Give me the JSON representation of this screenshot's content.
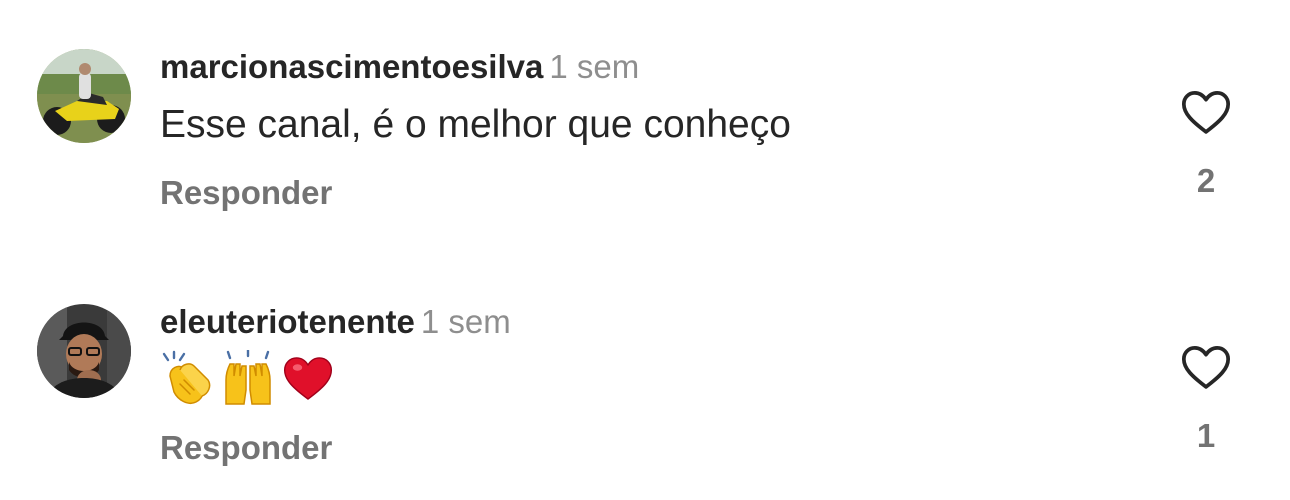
{
  "comments": [
    {
      "username": "marcionascimentoesilva",
      "time": "1 sem",
      "text": "Esse canal, é o melhor que conheço",
      "reply_label": "Responder",
      "like_count": "2",
      "avatar_icon": "avatar-motorcycle-photo"
    },
    {
      "username": "eleuteriotenente",
      "time": "1 sem",
      "emojis": [
        "clapping-hands",
        "raising-hands",
        "red-heart"
      ],
      "reply_label": "Responder",
      "like_count": "1",
      "avatar_icon": "avatar-person-cap-photo"
    }
  ],
  "colors": {
    "username": "#262626",
    "secondary": "#8e8e8e",
    "muted": "#737373",
    "heart": "#e0102a",
    "emoji_yellow": "#f7c21a"
  }
}
